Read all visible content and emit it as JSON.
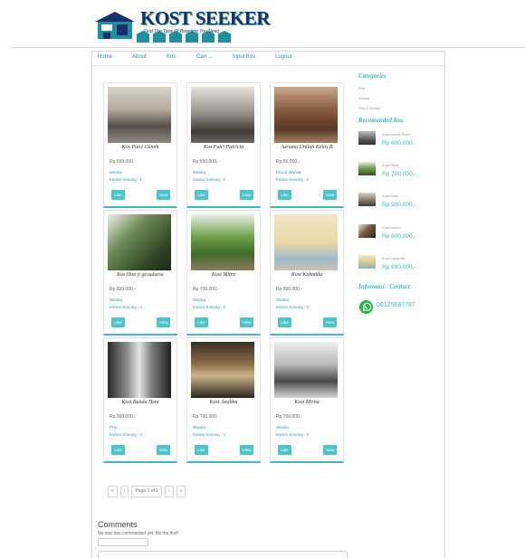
{
  "header": {
    "logo_title": "KOST SEEKER",
    "logo_tagline": "Find The Type Of Boarding You Need"
  },
  "nav": [
    "Home",
    "About",
    "Kos",
    "Cari ...",
    "Input Kos",
    "Logout"
  ],
  "listings": [
    {
      "name": "Kos Putri Cantik",
      "price": "Rp 550.000,-",
      "gender": "Wanita",
      "rooms": "Kamar Kosong : 1",
      "like": "Like",
      "view": "View"
    },
    {
      "name": "Kos Putri Patricia",
      "price": "Rp 550.000,-",
      "gender": "Wanita",
      "rooms": "Kamar Kosong : 2",
      "like": "Like",
      "view": "View"
    },
    {
      "name": "Asrama Unilah Kelas B",
      "price": "Rp 50.000,-",
      "gender": "Pria & Wanita",
      "rooms": "Kamar Kosong : 6",
      "like": "Like",
      "view": "View"
    },
    {
      "name": "Kos Haa ji gesuduese",
      "price": "Rp 600.000,-",
      "gender": "Wanita",
      "rooms": "Kamar Kosong : 4",
      "like": "Like",
      "view": "View"
    },
    {
      "name": "Kost Mitra",
      "price": "Rp 700.000,-",
      "gender": "Wanita",
      "rooms": "Kamar Kosong : 2",
      "like": "Like",
      "view": "View"
    },
    {
      "name": "Kost Kakanda",
      "price": "Rp 600.000,-",
      "gender": "Wanita",
      "rooms": "Kamar Kosong : 3",
      "like": "Like",
      "view": "View"
    },
    {
      "name": "Kost Bunda Heni",
      "price": "Rp 500.000,-",
      "gender": "Pria",
      "rooms": "Kamar Kosong : 4",
      "like": "Like",
      "view": "View"
    },
    {
      "name": "Kost Anabba",
      "price": "Rp 700.000,-",
      "gender": "Wanita",
      "rooms": "Kamar Kosong : 4",
      "like": "Like",
      "view": "View"
    },
    {
      "name": "Kost Mirna",
      "price": "Rp 700.000,-",
      "gender": "Wanita",
      "rooms": "Kamar Kosong : 4",
      "like": "Like",
      "view": "View"
    }
  ],
  "pagination": {
    "first": "«",
    "prev": "‹",
    "label": "Page 1 of 2",
    "next": "›",
    "last": "»"
  },
  "comments": {
    "title": "Comments",
    "empty_note": "No one has commented yet. Be the first!"
  },
  "sidebar": {
    "categories_title": "Categories",
    "categories": [
      "Pria",
      "Wanita",
      "Pria & Wanita"
    ],
    "recommended_title": "Recomended Kos",
    "recommended": [
      {
        "name": "Kost Bunda Rumi",
        "price": "Rp 600.000,-"
      },
      {
        "name": "Kost Mitra",
        "price": "Rp 700.000,-"
      },
      {
        "name": "Kost Babe",
        "price": "Rp 500.000,-"
      },
      {
        "name": "Kost Mansi",
        "price": "Rp 600.000,-"
      },
      {
        "name": "Kost Kakanda",
        "price": "Rp 600.000,-"
      }
    ],
    "contact_title": "Informasi / Contact",
    "phone": "08125687787"
  },
  "colors": {
    "accent": "#3ab8c4",
    "button": "#4cc4c9",
    "logo_navy": "#1a2f6b",
    "whatsapp": "#25b34a"
  }
}
